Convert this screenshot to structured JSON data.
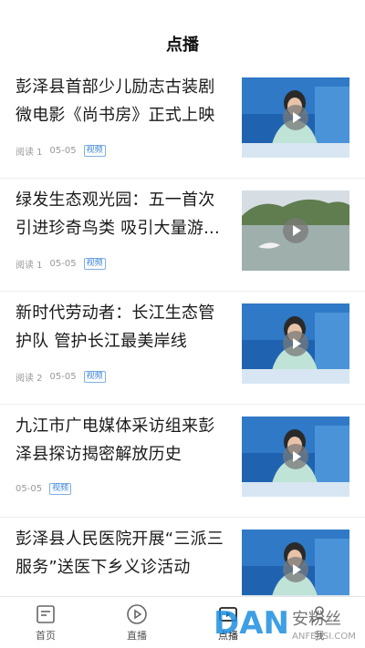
{
  "header": {
    "title": "点播"
  },
  "items": [
    {
      "title": "彭泽县首部少儿励志古装剧微电影《尚书房》正式上映",
      "reads": "阅读 1",
      "date": "05-05",
      "badge": "视频"
    },
    {
      "title": "绿发生态观光园：五一首次引进珍奇鸟类 吸引大量游...",
      "reads": "阅读 1",
      "date": "05-05",
      "badge": "视频"
    },
    {
      "title": "新时代劳动者：长江生态管护队 管护长江最美岸线",
      "reads": "阅读 2",
      "date": "05-05",
      "badge": "视频"
    },
    {
      "title": "九江市广电媒体采访组来彭泽县探访揭密解放历史",
      "reads": "",
      "date": "05-05",
      "badge": "视频"
    },
    {
      "title": "彭泽县人民医院开展“三派三服务”送医下乡义诊活动",
      "reads": "",
      "date": "",
      "badge": ""
    }
  ],
  "tabbar": {
    "tabs": [
      {
        "label": "首页",
        "icon": "news-icon"
      },
      {
        "label": "直播",
        "icon": "play-circle-icon"
      },
      {
        "label": "点播",
        "icon": "vod-icon"
      },
      {
        "label": "我",
        "icon": "user-icon"
      }
    ],
    "active": "点播"
  },
  "watermark": {
    "brand": "DAN",
    "cn": "安粉丝",
    "url": "ANFENSI.COM"
  }
}
